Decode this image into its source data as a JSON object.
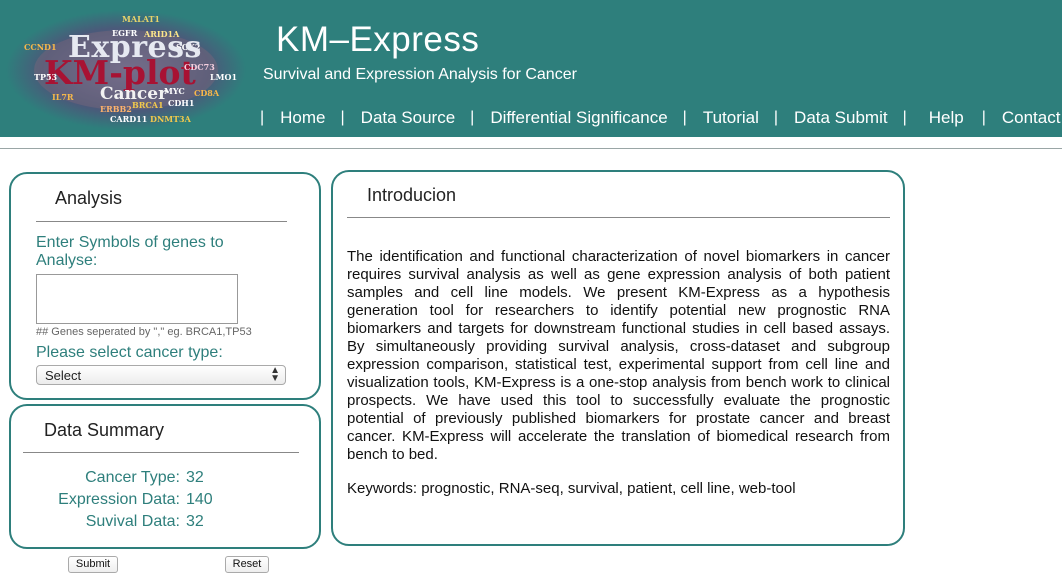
{
  "header": {
    "logo": {
      "word_express": "Express",
      "word_kmplot": "KM-plot",
      "word_cancer": "Cancer",
      "small_words": [
        "EGFR",
        "ARID1A",
        "SOX2",
        "MALAT1",
        "CCND1",
        "MYC",
        "IL7R",
        "CD8A",
        "BRCA1",
        "TP53",
        "CDH1",
        "LMO1",
        "DNMT3A",
        "CARD11",
        "ERBB2",
        "CDC73"
      ]
    },
    "title": "KM–Express",
    "subtitle": "Survival and Expression Analysis for Cancer",
    "nav": [
      {
        "label": "Home"
      },
      {
        "label": "Data Source"
      },
      {
        "label": "Differential Significance"
      },
      {
        "label": "Tutorial"
      },
      {
        "label": "Data Submit"
      },
      {
        "label": "Help"
      },
      {
        "label": "Contact us"
      }
    ]
  },
  "analysis": {
    "heading": "Analysis",
    "gene_label": "Enter Symbols of genes to Analyse:",
    "gene_value": "",
    "gene_hint": "## Genes seperated by \",\" eg. BRCA1,TP53",
    "cancer_label": "Please select cancer type:",
    "cancer_selected": "Select"
  },
  "summary": {
    "heading": "Data Summary",
    "rows": [
      {
        "label": "Cancer Type:",
        "value": "32"
      },
      {
        "label": "Expression Data:",
        "value": "140"
      },
      {
        "label": "Suvival Data:",
        "value": "32"
      }
    ]
  },
  "intro": {
    "heading": "Introducion",
    "body": "The identification and functional characterization of novel biomarkers in cancer requires survival analysis as well as gene expression analysis of both patient samples and cell line models. We present KM-Express as a hypothesis generation tool for researchers to identify potential new prognostic RNA biomarkers and targets for downstream functional studies in cell based assays. By simultaneously providing survival analysis, cross-dataset and subgroup expression comparison, statistical test, experimental support from cell line and visualization tools, KM-Express is a one-stop analysis from bench work to clinical prospects. We have used this tool to successfully evaluate the prognostic potential of previously published biomarkers for prostate cancer and breast cancer. KM-Express will accelerate the translation of biomedical research from bench to bed.",
    "keywords": "Keywords: prognostic, RNA-seq, survival, patient, cell line, web-tool"
  },
  "buttons": {
    "submit": "Submit",
    "reset": "Reset"
  },
  "colors": {
    "header_bg": "#2e7f7c",
    "accent": "#2e7f7c",
    "logo_red": "#a81233"
  }
}
